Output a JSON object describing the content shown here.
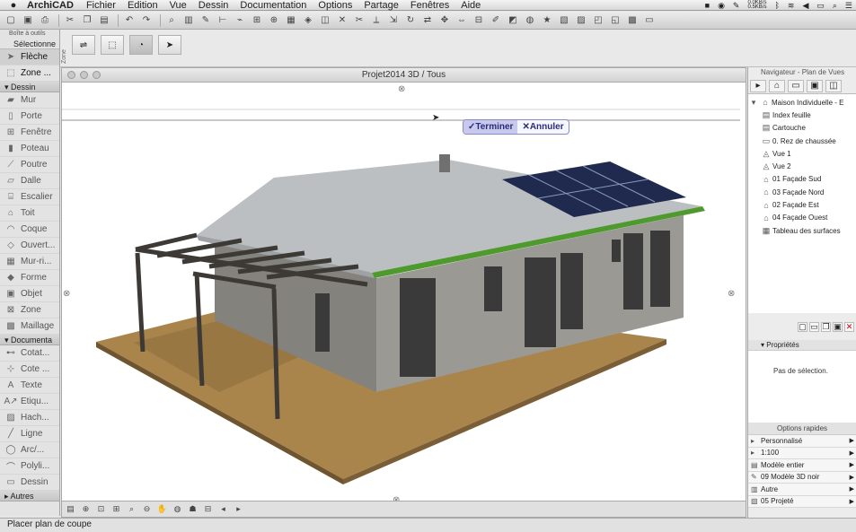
{
  "menubar": {
    "app": "ArchiCAD",
    "menus": [
      "Fichier",
      "Edition",
      "Vue",
      "Dessin",
      "Documentation",
      "Options",
      "Partage",
      "Fenêtres",
      "Aide"
    ],
    "net_up": "0.0KB/s",
    "net_down": "0.5KB/s"
  },
  "palette": {
    "title": "Boîte à outils",
    "selection": "Sélectionne",
    "top_items": [
      {
        "label": "Flèche",
        "icon": "arrow"
      },
      {
        "label": "Zone ...",
        "icon": "marquee"
      }
    ],
    "section_dessin": "Dessin",
    "dessin_items": [
      "Mur",
      "Porte",
      "Fenêtre",
      "Poteau",
      "Poutre",
      "Dalle",
      "Escalier",
      "Toit",
      "Coque",
      "Ouvert...",
      "Mur-ri...",
      "Forme",
      "Objet",
      "Zone",
      "Maillage"
    ],
    "section_doc": "Documenta",
    "doc_items": [
      "Cotat...",
      "Cote ...",
      "Texte",
      "Etiqu...",
      "Hach...",
      "Ligne",
      "Arc/...",
      "Polyli...",
      "Dessin"
    ],
    "section_autres": "Autres"
  },
  "infobox": {
    "zone_label": "Zone"
  },
  "view": {
    "title": "Projet2014 3D / Tous"
  },
  "confirm": {
    "ok": "✓Terminer",
    "cancel": "✕Annuler"
  },
  "navigator": {
    "title": "Navigateur - Plan de Vues",
    "tree": [
      {
        "label": "Maison Individuelle - E",
        "icon": "house",
        "indent": 0
      },
      {
        "label": "Index feuille",
        "icon": "sheet",
        "indent": 1
      },
      {
        "label": "Cartouche",
        "icon": "sheet",
        "indent": 1
      },
      {
        "label": "0. Rez de chaussée",
        "icon": "folder",
        "indent": 1
      },
      {
        "label": "Vue 1",
        "icon": "view",
        "indent": 1
      },
      {
        "label": "Vue 2",
        "icon": "view",
        "indent": 1
      },
      {
        "label": "01 Façade Sud",
        "icon": "facade",
        "indent": 1
      },
      {
        "label": "03 Façade Nord",
        "icon": "facade",
        "indent": 1
      },
      {
        "label": "02 Façade Est",
        "icon": "facade",
        "indent": 1
      },
      {
        "label": "04 Façade Ouest",
        "icon": "facade",
        "indent": 1
      },
      {
        "label": "Tableau des surfaces",
        "icon": "table",
        "indent": 1
      }
    ],
    "props_title": "Propriétés",
    "props_body": "Pas de sélection.",
    "quick_title": "Options rapides",
    "quick_options": [
      "Personnalisé",
      "1:100",
      "Modèle entier",
      "09 Modèle 3D noir",
      "Autre",
      "05 Projeté"
    ]
  },
  "status": {
    "text": "Placer plan de coupe"
  },
  "colors": {
    "panel": "#6d9b3a",
    "roof": "#b9bcbf",
    "wall": "#9b9a94",
    "ground": "#a9854c",
    "solar": "#1f2a4e"
  }
}
